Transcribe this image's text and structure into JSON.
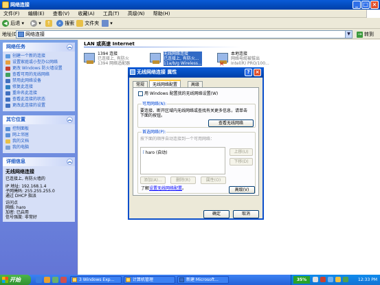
{
  "window": {
    "title": "网络连接"
  },
  "menu": [
    "文件(F)",
    "编辑(E)",
    "查看(V)",
    "收藏(A)",
    "工具(T)",
    "高级(N)",
    "帮助(H)"
  ],
  "toolbar": {
    "back": "后退",
    "search": "搜索",
    "folders": "文件夹"
  },
  "address": {
    "label": "地址(D)",
    "value": "网络连接",
    "go": "转到"
  },
  "left_pane": {
    "network_tasks": {
      "title": "网络任务",
      "items": [
        "创建一个新的连接",
        "设置家庭或小型办公网络",
        "更改 Windows 防火墙设置",
        "查看可用的无线网络",
        "禁用此网络设备",
        "修复此连接",
        "重命名此连接",
        "查看此连接的状态",
        "更改此连接的设置"
      ]
    },
    "other_places": {
      "title": "其它位置",
      "items": [
        "控制面板",
        "网上邻居",
        "我的文档",
        "我的电脑"
      ]
    },
    "details": {
      "title": "详细信息",
      "name": "无线网络连接",
      "lines": [
        "已连接上, 有防火墙的",
        "IP 地址: 192.168.1.4",
        "子网掩码: 255.255.255.0",
        "通过 DHCP 指派",
        "访问点",
        "网络: haro",
        "加密: 已启用",
        "信号强度: 非常好"
      ]
    }
  },
  "main": {
    "section_title": "LAN 或高速 Internet",
    "connections": [
      {
        "name": "1394 连接",
        "status": "已连接上, 有防火",
        "device": "1394 网络适配器"
      },
      {
        "name": "无线网络连接",
        "status": "已连接上, 有防火...",
        "device": "11a/b/g Wireless..."
      },
      {
        "name": "本地连接",
        "status": "网络电缆被拔出",
        "device": "Intel(R) PRO/100..."
      }
    ]
  },
  "dialog": {
    "title": "无线网络连接 属性",
    "tabs": [
      "常规",
      "无线网络配置",
      "高级"
    ],
    "active_tab": "无线网络配置",
    "use_windows_checkbox": "用 Windows 配置我的无线网络设置(W)",
    "available": {
      "label": "可用网络(N):",
      "text": "要连接、断开区域内无线网络或查找有关更多信息，请单击下面的按钮。",
      "button": "查看无线网络"
    },
    "preferred": {
      "label": "首选网络(P):",
      "text": "按下面的顺序自动连接到一个可用网络：",
      "list_item": "haro (自动)",
      "move_up": "上移(U)",
      "move_down": "下移(D)",
      "add": "添加(A)...",
      "remove": "删除(R)",
      "properties": "属性(O)"
    },
    "learn": {
      "prefix": "了解",
      "link": "设置无线网络配置",
      "suffix": "。"
    },
    "advanced_button": "高级(V)",
    "ok": "确定",
    "cancel": "取消"
  },
  "taskbar": {
    "start": "开始",
    "buttons": [
      "3 Windows Exp...",
      "计算机管理",
      "新建 Microsoft..."
    ],
    "tray_badge": "35%",
    "clock": "12:33 PM"
  }
}
